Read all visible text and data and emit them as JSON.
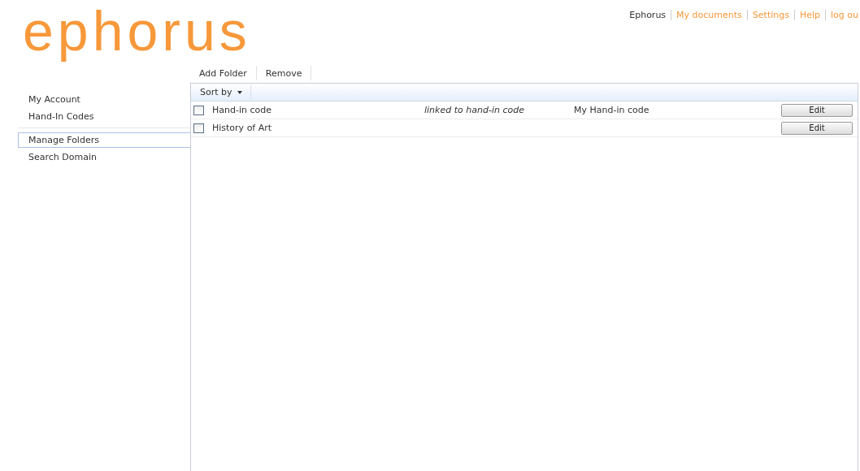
{
  "logo": "ephorus",
  "top_nav": [
    {
      "label": "Ephorus",
      "selected": true
    },
    {
      "label": "My documents",
      "selected": false
    },
    {
      "label": "Settings",
      "selected": false
    },
    {
      "label": "Help",
      "selected": false
    },
    {
      "label": "log ou",
      "selected": false
    }
  ],
  "toolbar": [
    "Add Folder",
    "Remove"
  ],
  "sidebar": {
    "groups": [
      [
        {
          "label": "My Account",
          "selected": false
        },
        {
          "label": "Hand-In Codes",
          "selected": false
        }
      ],
      [
        {
          "label": "Manage Folders",
          "selected": true
        },
        {
          "label": "Search Domain",
          "selected": false
        }
      ]
    ]
  },
  "sort_by": "Sort by",
  "folders": [
    {
      "checked": false,
      "name": "Hand-in code",
      "link_note": "linked to hand-in code",
      "code": "My Hand-in code",
      "button": "Edit"
    },
    {
      "checked": false,
      "name": "History of Art",
      "button": "Edit"
    }
  ]
}
